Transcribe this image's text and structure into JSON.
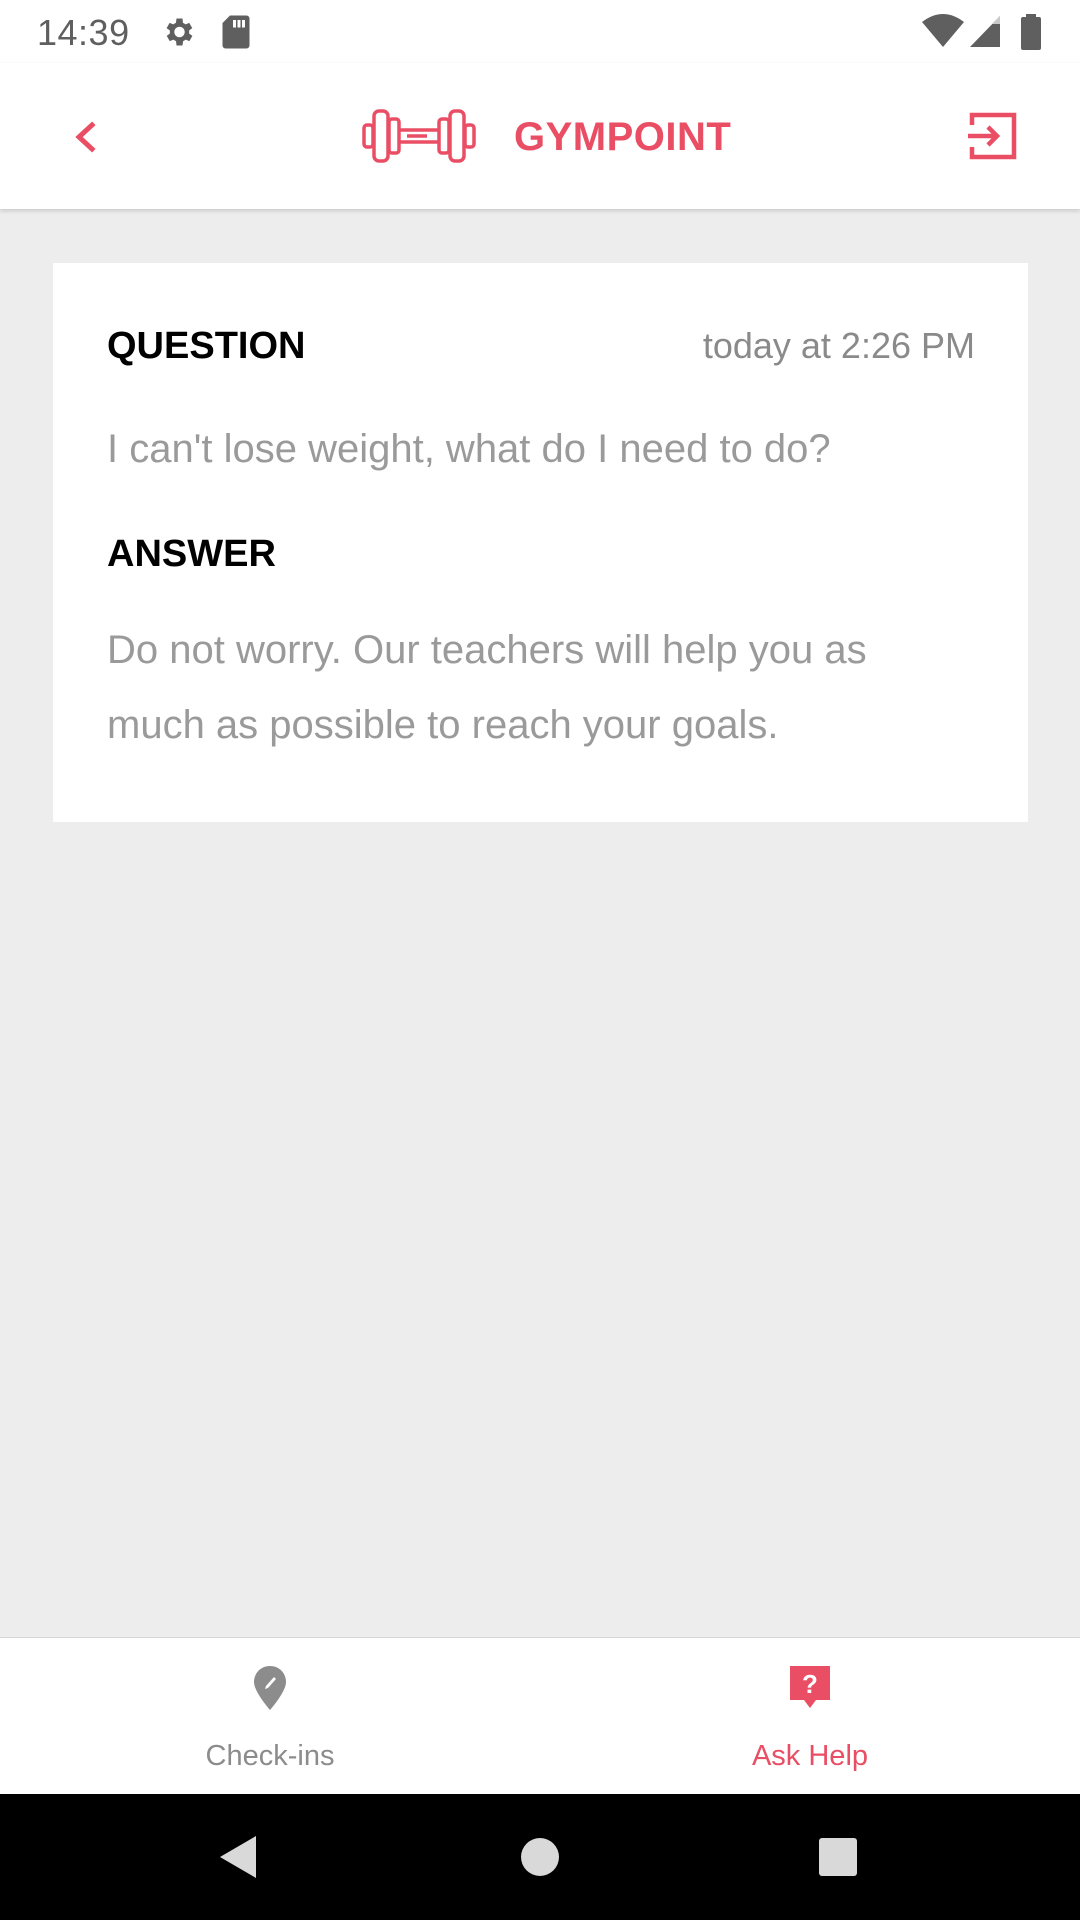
{
  "status_bar": {
    "time": "14:39",
    "icons": [
      "gear-icon",
      "sd-card-icon",
      "wifi-icon",
      "signal-icon",
      "battery-icon"
    ]
  },
  "app_bar": {
    "brand": "GYMPOINT",
    "back_icon": "chevron-left-icon",
    "logo_icon": "dumbbell-icon",
    "logout_icon": "logout-icon"
  },
  "card": {
    "question_heading": "QUESTION",
    "question_date": "today at 2:26 PM",
    "question_text": "I can't lose weight, what do I need to do?",
    "answer_heading": "ANSWER",
    "answer_text": "Do not worry. Our teachers will help you as much as possible to reach your goals."
  },
  "bottom_nav": {
    "items": [
      {
        "label": "Check-ins",
        "icon": "location-pin-icon",
        "active": false
      },
      {
        "label": "Ask Help",
        "icon": "question-bubble-icon",
        "active": true
      }
    ]
  },
  "colors": {
    "accent": "#e94e64",
    "background": "#ededed",
    "inactive": "#8c8c8c"
  },
  "system_nav": [
    "back-triangle-icon",
    "home-circle-icon",
    "recents-square-icon"
  ]
}
